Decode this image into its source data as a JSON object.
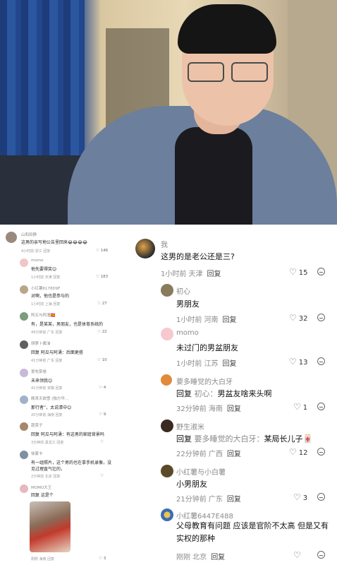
{
  "left_comments": [
    {
      "name": "山和田静",
      "text": "这男的亲写地公告里回来😂😂😂😂",
      "meta": "4小时前 浙江  回复",
      "likes": "146"
    },
    {
      "name": "momo",
      "text": "他先要得奖😊",
      "meta": "1小时前 天津  回复",
      "likes": "183"
    },
    {
      "name": "小红薯6178D9F",
      "text": "对啊，他也是参与的",
      "meta": "1小时前 上海  回复",
      "likes": "27"
    },
    {
      "name": "阿五与阿涌🇪🇸",
      "text": "有，是某某，男朋友，也是体育系统的",
      "meta": "49分钟前 广东  回复",
      "likes": "22"
    },
    {
      "name": "胡萝卜酱油",
      "text": "回复 阿瓜与阿涌：后面更搭",
      "meta": "41分钟前 广东  回复",
      "likes": "10"
    },
    {
      "name": "爱吃菜卷",
      "text": "未来领我😊",
      "meta": "41分钟前 安徽  回复",
      "likes": "4"
    },
    {
      "name": "晚来天欲雪 (独方华…",
      "text": "那行者”，太说清中😊",
      "meta": "20分钟前 海南  回复",
      "likes": "9"
    },
    {
      "name": "蔬菜子",
      "text": "回复 阿瓜与阿涌：有这男的家庭背景吗",
      "meta": "3分钟前 黑龙江  回复",
      "likes": ""
    },
    {
      "name": "徐蒙卡",
      "text": "有一组照片，这个男的也在拿手机录像，没",
      "text2": "见过理直气壮的，",
      "meta": "2分钟前 北京  回复",
      "likes": ""
    },
    {
      "name": "MOMO大王",
      "text": "回复 这是个",
      "meta": "刚刚 海南  回复",
      "likes": "3"
    }
  ],
  "right_comments": [
    {
      "name": "我",
      "text": "这男的是老公还是三?",
      "time_loc": "1小时前 天津",
      "reply": "回复",
      "likes": "15"
    },
    {
      "name": "初心",
      "text": "男朋友",
      "time_loc": "1小时前 河南",
      "reply": "回复",
      "likes": "32"
    },
    {
      "name": "momo",
      "text": "未过门的男盆朋友",
      "time_loc": "1小时前 江苏",
      "reply": "回复",
      "likes": "13"
    },
    {
      "name": "要多睡觉的大白牙",
      "reply_prefix": "回复",
      "reply_to": "初心：",
      "text": "男盆友啥来头啊",
      "time_loc": "32分钟前 海南",
      "reply": "回复",
      "likes": "1"
    },
    {
      "name": "野生淑米",
      "reply_prefix": "回复",
      "reply_to": "要多睡觉的大白牙：",
      "text": "某局长儿子🀄",
      "time_loc": "22分钟前 广西",
      "reply": "回复",
      "likes": "12"
    },
    {
      "name": "小红薯与小白薯",
      "text": "小男朋友",
      "time_loc": "21分钟前 广东",
      "reply": "回复",
      "likes": "3"
    },
    {
      "name": "小红薯6447E488",
      "text": "父母教育有问题 应该是官阶不太高 但是又有实权的那种",
      "time_loc": "刚刚 北京",
      "reply": "回复",
      "likes": ""
    }
  ],
  "colors": {
    "accent_text": "#111111",
    "muted": "#8a8a8a"
  }
}
